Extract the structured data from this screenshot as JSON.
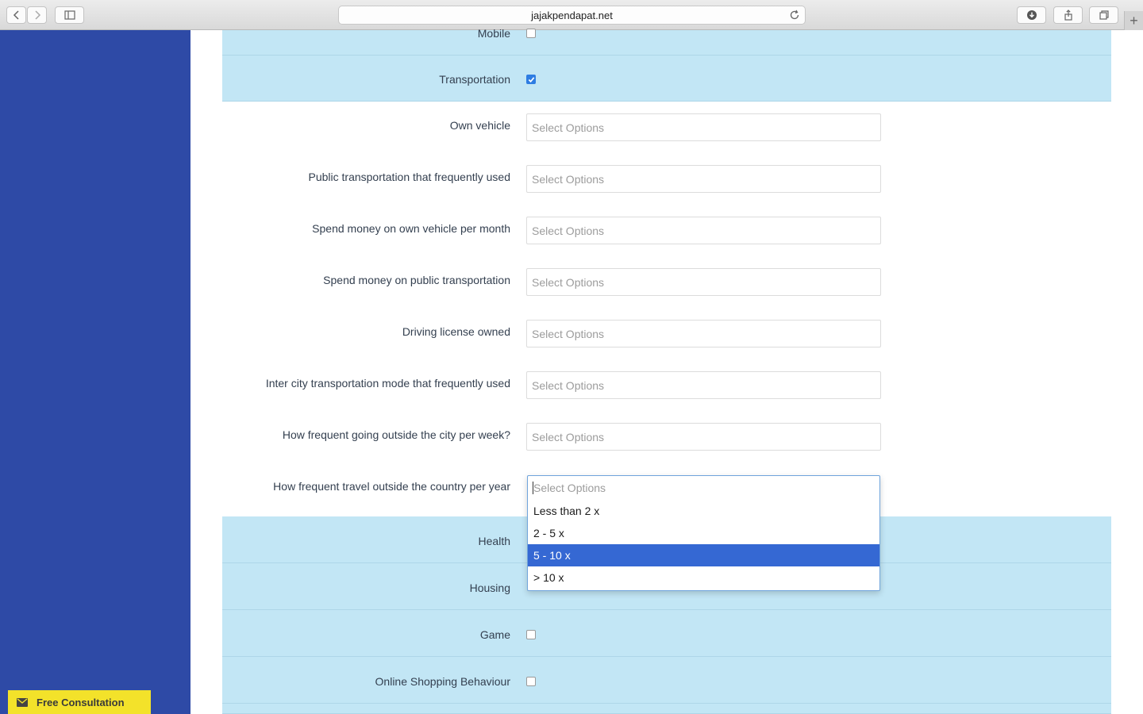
{
  "browser": {
    "url": "jajakpendapat.net"
  },
  "rows": {
    "mobile": "Mobile",
    "transportation": "Transportation",
    "health": "Health",
    "housing": "Housing",
    "game": "Game",
    "online_shopping": "Online Shopping Behaviour"
  },
  "transport_fields": [
    {
      "label": "Own vehicle",
      "placeholder": "Select Options"
    },
    {
      "label": "Public transportation that frequently used",
      "placeholder": "Select Options"
    },
    {
      "label": "Spend money on own vehicle per month",
      "placeholder": "Select Options"
    },
    {
      "label": "Spend money on public transportation",
      "placeholder": "Select Options"
    },
    {
      "label": "Driving license owned",
      "placeholder": "Select Options"
    },
    {
      "label": "Inter city transportation mode that frequently used",
      "placeholder": "Select Options"
    },
    {
      "label": "How frequent going outside the city per week?",
      "placeholder": "Select Options"
    },
    {
      "label": "How frequent travel outside the country per year",
      "placeholder": "Select Options"
    }
  ],
  "dropdown": {
    "options": [
      "Less than 2 x",
      "2 - 5 x",
      "5 - 10 x",
      "> 10 x"
    ],
    "highlighted": "5 - 10 x"
  },
  "consultation": {
    "label": "Free Consultation"
  },
  "colors": {
    "sidebar": "#2e4aa6",
    "row_highlight": "#c2e6f5",
    "option_highlight": "#3568d3",
    "consult_button": "#f3e22a"
  },
  "checkboxes": {
    "mobile": false,
    "transportation": true,
    "game": false,
    "online_shopping": false
  }
}
